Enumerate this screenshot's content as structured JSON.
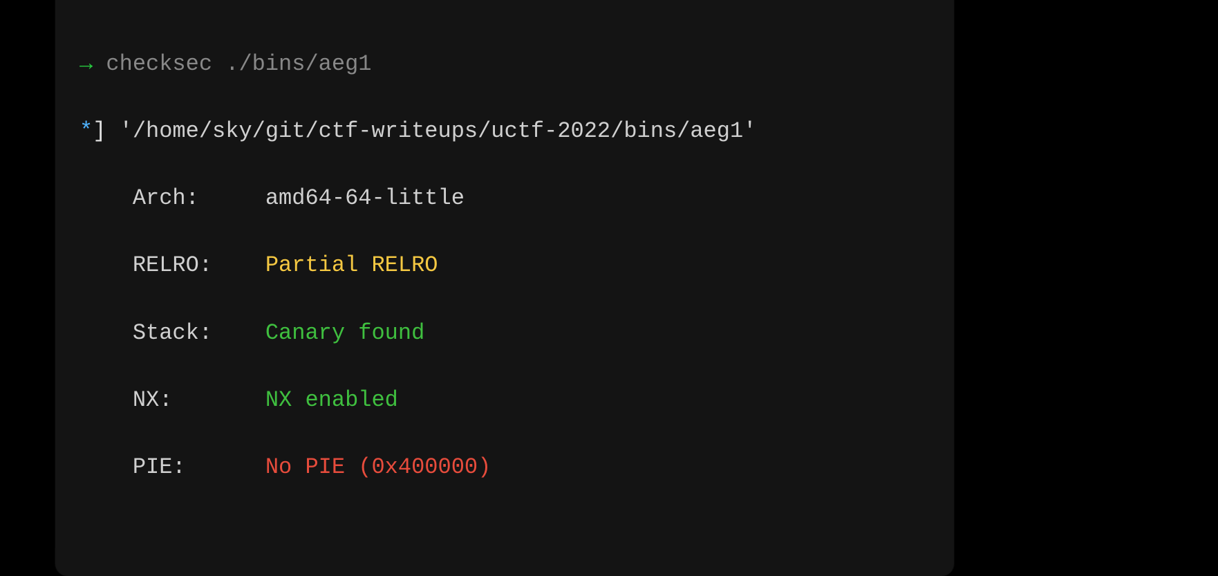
{
  "prompt": {
    "arrow": "→",
    "command": "checksec ./bins/aeg1"
  },
  "header": {
    "star": "*",
    "bracket": "]",
    "path": "'/home/sky/git/ctf-writeups/uctf-2022/bins/aeg1'"
  },
  "rows": {
    "arch": {
      "label": "Arch:",
      "value": "amd64-64-little"
    },
    "relro": {
      "label": "RELRO:",
      "value": "Partial RELRO"
    },
    "stack": {
      "label": "Stack:",
      "value": "Canary found"
    },
    "nx": {
      "label": "NX:",
      "value": "NX enabled"
    },
    "pie": {
      "label": "PIE:",
      "value": "No PIE (0x400000)"
    }
  }
}
